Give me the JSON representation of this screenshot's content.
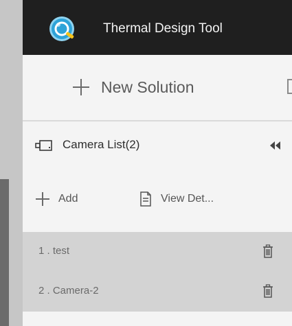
{
  "window": {
    "title": "Thermal Design Tool"
  },
  "toolbar": {
    "new_solution_label": "New Solution"
  },
  "camera_panel": {
    "header": "Camera List(2)",
    "add_label": "Add",
    "view_details_label": "View Det..."
  },
  "cameras": [
    {
      "label": "1 . test"
    },
    {
      "label": "2 . Camera-2"
    }
  ],
  "icons": {
    "logo": "app-logo-icon",
    "new": "plus-icon",
    "save": "save-icon",
    "camera": "camera-icon",
    "collapse": "double-chevron-left-icon",
    "add": "plus-icon",
    "details": "document-icon",
    "delete": "trash-icon"
  },
  "colors": {
    "titlebar_bg": "#1f1f1f",
    "panel_bg": "#f4f4f4",
    "row_bg": "#d3d3d3",
    "logo_accent": "#2ea3d8"
  }
}
